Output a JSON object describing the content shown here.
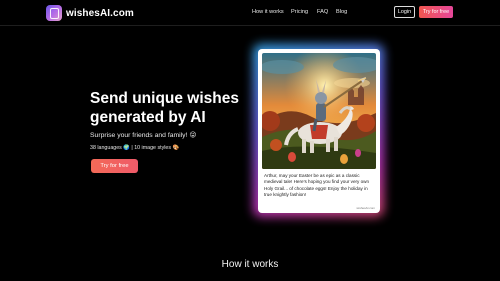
{
  "nav": {
    "brand": "wishesAI.com",
    "links": [
      "How it works",
      "Pricing",
      "FAQ",
      "Blog"
    ],
    "login": "Login",
    "cta": "Try for free"
  },
  "hero": {
    "title": "Send unique wishes generated by AI",
    "subtitle": "Surprise your friends and family! 😜",
    "meta": "38 languages 🌍 | 10 image styles 🎨",
    "cta": "Try for free"
  },
  "card": {
    "message": "Arthur, may your Easter be as epic as a classic medieval tale! Here's hoping you find your very own Holy Grail... of chocolate eggs! Enjoy the holiday in true knightly fashion!",
    "mark": "wishesAI.com"
  },
  "section": {
    "title": "How it works"
  },
  "colors": {
    "accent_start": "#f0564f",
    "accent_end": "#e6479a",
    "background": "#000000"
  }
}
